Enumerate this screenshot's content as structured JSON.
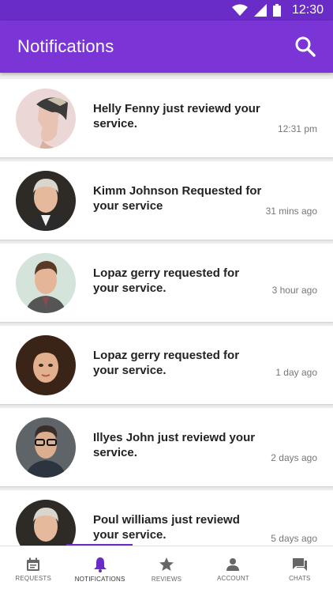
{
  "status_bar": {
    "time": "12:30"
  },
  "app_bar": {
    "title": "Notifications"
  },
  "notifications": [
    {
      "message": "Helly Fenny just reviewd your service.",
      "time": "12:31 pm"
    },
    {
      "message": "Kimm Johnson Requested for your service",
      "time": "31 mins ago"
    },
    {
      "message": "Lopaz gerry requested for your service.",
      "time": "3 hour ago"
    },
    {
      "message": "Lopaz gerry requested for your service.",
      "time": "1 day ago"
    },
    {
      "message": "Illyes John just reviewd your service.",
      "time": "2 days ago"
    },
    {
      "message": "Poul williams just reviewd your service.",
      "time": "5 days ago"
    }
  ],
  "bottom_nav": {
    "items": [
      {
        "label": "REQUESTS",
        "icon": "calendar-icon"
      },
      {
        "label": "NOTIFICATIONS",
        "icon": "bell-icon"
      },
      {
        "label": "REVIEWS",
        "icon": "star-icon"
      },
      {
        "label": "ACCOUNT",
        "icon": "person-icon"
      },
      {
        "label": "CHATS",
        "icon": "chat-icon"
      }
    ],
    "active": "NOTIFICATIONS"
  },
  "colors": {
    "status_bar": "#6a2cc7",
    "app_bar": "#7b35d6",
    "accent": "#6a2cc7"
  }
}
